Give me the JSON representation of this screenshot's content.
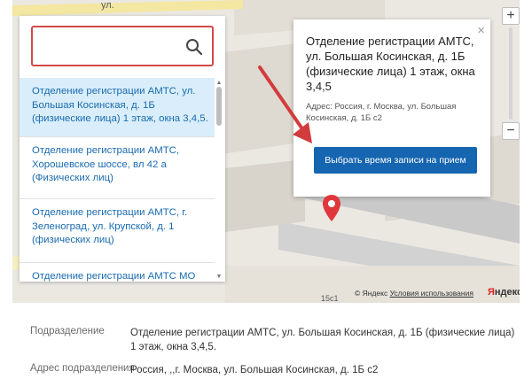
{
  "map": {
    "street_labels": {
      "top": "ул.",
      "building": "15с1"
    },
    "zoom": {
      "in_label": "+",
      "out_label": "−"
    },
    "attribution": {
      "copyright": "© Яндекс",
      "terms": "Условия использования",
      "logo_ya": "Я",
      "logo_rest": "ндекс"
    }
  },
  "search": {
    "value": "",
    "placeholder": ""
  },
  "results": [
    {
      "text": "Отделение регистрации АМТС, ул. Большая Косинская, д. 1Б (физические лица) 1 этаж, окна 3,4,5.",
      "active": true
    },
    {
      "text": "Отделение регистрации АМТС, Хорошевское шоссе, вл 42 а (Физических лиц)",
      "active": false
    },
    {
      "text": "Отделение регистрации АМТС, г. Зеленоград, ул. Крупской, д. 1 (физических лиц)",
      "active": false
    },
    {
      "text": "Отделение регистрации АМТС МО",
      "active": false
    }
  ],
  "balloon": {
    "title": "Отделение регистрации АМТС, ул. Большая Косинская, д. 1Б (физические лица) 1 этаж, окна 3,4,5",
    "address": "Адрес: Россия, г. Москва, ул. Большая Косинская, д. 1Б с2",
    "button_label": "Выбрать время записи на прием",
    "close_label": "×"
  },
  "details": [
    {
      "label": "Подразделение",
      "value": "Отделение регистрации АМТС, ул. Большая Косинская, д. 1Б (физические лица) 1 этаж, окна 3,4,5."
    },
    {
      "label": "Адрес подразделения",
      "value": "Россия, ,,г. Москва, ул. Большая Косинская, д. 1Б с2"
    }
  ],
  "colors": {
    "accent_button": "#1565b0",
    "link_text": "#1a6bb0",
    "active_item_bg": "#d9eefa",
    "search_border": "#d24a4a",
    "arrow": "#d23c3c",
    "marker": "#e0373d"
  },
  "icons": {
    "search": "search-icon",
    "marker": "map-pin-icon",
    "close": "close-icon",
    "arrow": "red-arrow-annotation"
  }
}
